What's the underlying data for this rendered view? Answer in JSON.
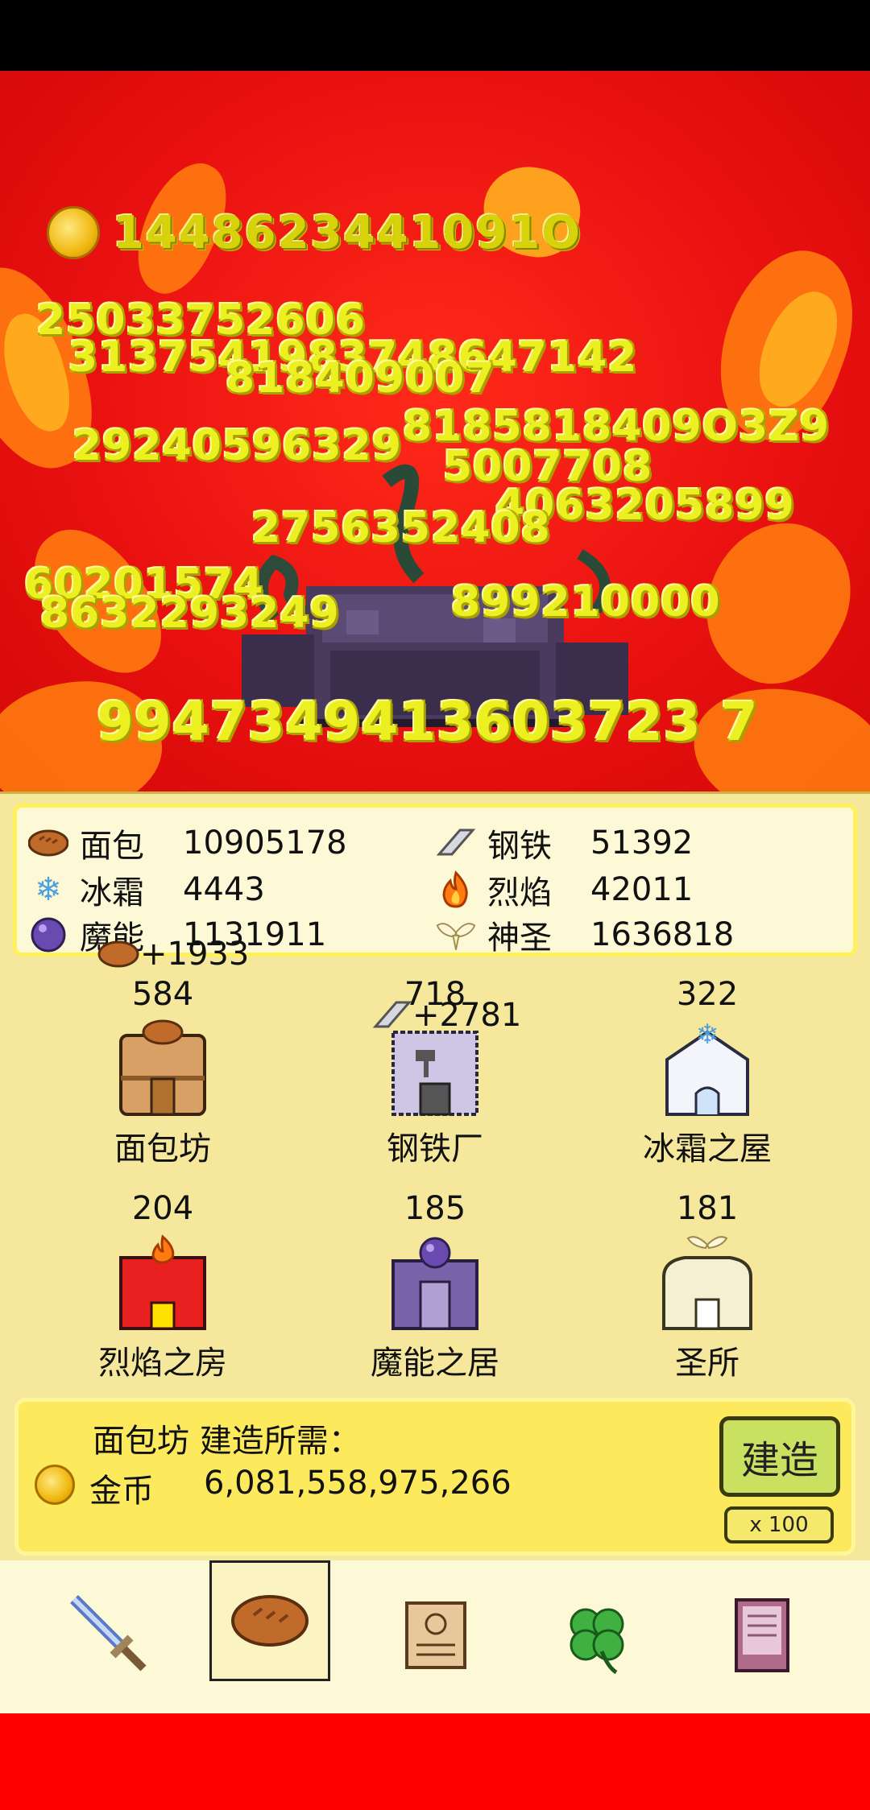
{
  "hud": {
    "coins": "1448623441091O"
  },
  "damage_numbers": [
    "25033752606",
    "3137541983748647142",
    "818409007",
    "8185818409O3Z9",
    "29240596329",
    "5007708",
    "4063205899",
    "2756352408",
    "60201574",
    "8632293249",
    "899210000",
    "9947349413603723 7"
  ],
  "resources": [
    {
      "name": "面包",
      "value": "10905178",
      "icon": "bread-icon"
    },
    {
      "name": "钢铁",
      "value": "51392",
      "icon": "steel-ingot-icon"
    },
    {
      "name": "冰霜",
      "value": "4443",
      "icon": "snowflake-icon"
    },
    {
      "name": "烈焰",
      "value": "42011",
      "icon": "flame-icon"
    },
    {
      "name": "魔能",
      "value": "1131911",
      "icon": "magic-orb-icon"
    },
    {
      "name": "神圣",
      "value": "1636818",
      "icon": "holy-wings-icon"
    }
  ],
  "floats": {
    "bread_gain": "+1933",
    "steel_gain": "+2781"
  },
  "buildings": [
    {
      "name": "面包坊",
      "count": "584"
    },
    {
      "name": "钢铁厂",
      "count": "718"
    },
    {
      "name": "冰霜之屋",
      "count": "322"
    },
    {
      "name": "烈焰之房",
      "count": "204"
    },
    {
      "name": "魔能之居",
      "count": "185"
    },
    {
      "name": "圣所",
      "count": "181"
    }
  ],
  "build_cost": {
    "title": "面包坊 建造所需：",
    "currency": "金币",
    "amount": "6,081,558,975,266",
    "build_label": "建造",
    "multiplier_label": "x 100"
  },
  "tabs": [
    "sword-icon",
    "bread-icon",
    "scroll-icon",
    "clover-icon",
    "book-icon"
  ],
  "colors": {
    "arena_red": "#e81010",
    "panel": "#f5e89c",
    "damage_yellow": "#ecf020"
  }
}
